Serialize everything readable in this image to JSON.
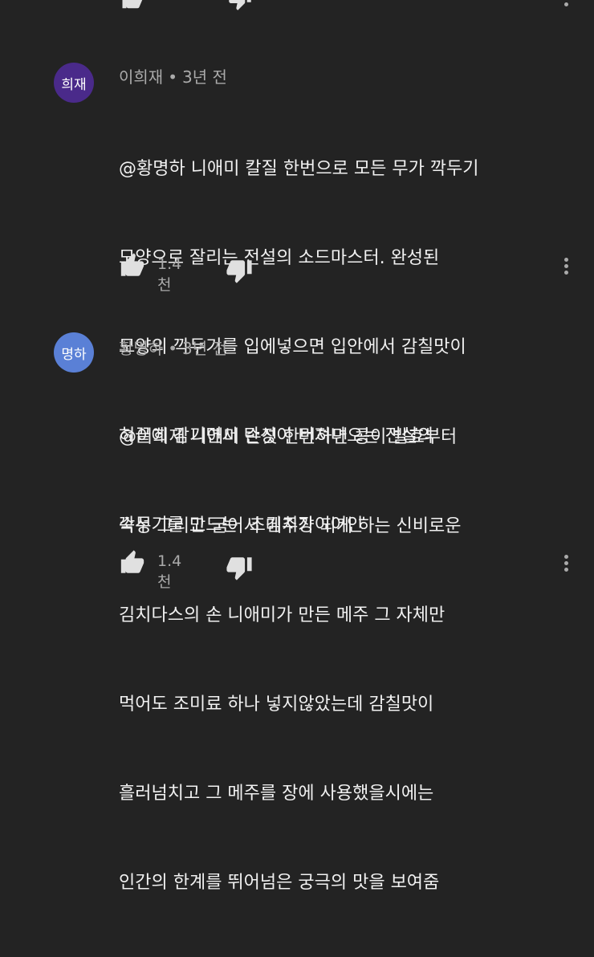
{
  "comments": [
    {
      "avatar_text": "희재",
      "avatar_color": "#4a2a8a",
      "author": "이희재",
      "time": "3년 전",
      "lines": [
        "@황명하 니애미 칼질 한번으로 모든 무가 깍두기",
        "모양으로 잘리는 전설의 소드마스터. 완성된",
        "모양의 깍두기를 입에넣으면 입안에서 감칠맛이",
        "혀끝에 감기면서 탄성이 터져나오는 전설의",
        "깍두기를 만드는  초김치장이어인"
      ],
      "likes": "1.4천"
    },
    {
      "avatar_text": "명하",
      "avatar_color": "#5a80d6",
      "author": "황명하",
      "time": "3년 전",
      "lines": [
        "@이희재 니애미 손짓 한번하면 콩이 발효부터",
        "숙성 그리고 굳어서 메주가 되게 하는 신비로운",
        "김치다스의 손 니애미가 만든 메주 그 자체만",
        "먹어도 조미료 하나 넣지않았는데 감칠맛이",
        "흘러넘치고 그 메주를 장에 사용했을시에는",
        "인간의 한계를 뛰어넘은 궁극의 맛을 보여줌"
      ],
      "likes": "1.4천"
    }
  ],
  "icons": {
    "like": "thumb-up-icon",
    "dislike": "thumb-down-icon",
    "more": "more-vert-icon"
  }
}
